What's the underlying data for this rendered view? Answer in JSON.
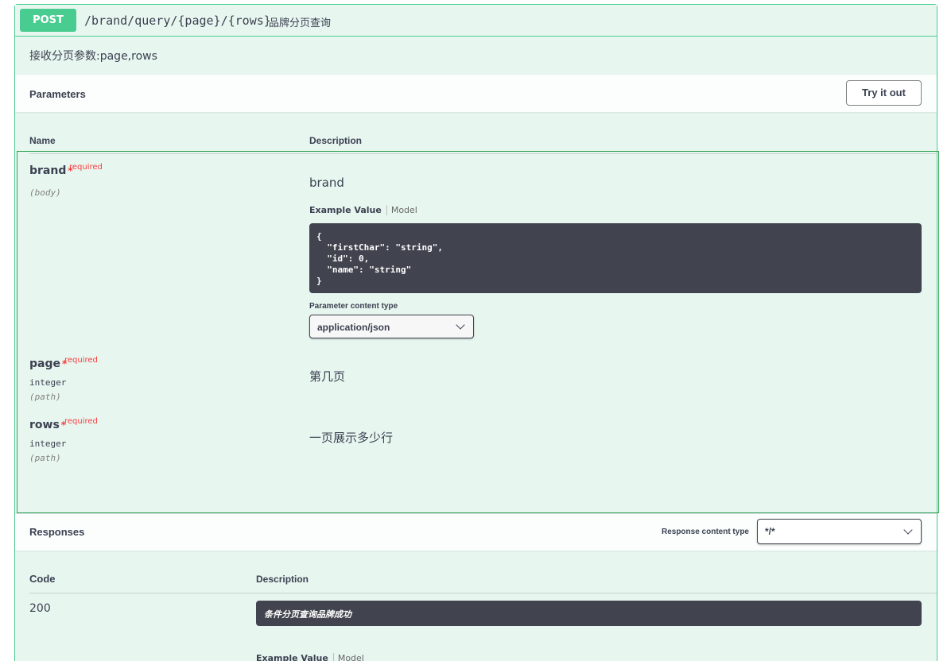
{
  "operation": {
    "method": "POST",
    "path": "/brand/query/{page}/{rows}",
    "summary": "品牌分页查询",
    "description": "接收分页参数:page,rows"
  },
  "parameters": {
    "title": "Parameters",
    "try_it_out": "Try it out",
    "col_name": "Name",
    "col_description": "Description",
    "required_label": "required",
    "required_star": "*",
    "items": [
      {
        "name": "brand",
        "type": "",
        "in": "(body)",
        "description": "brand"
      },
      {
        "name": "page",
        "type": "integer",
        "in": "(path)",
        "description": "第几页"
      },
      {
        "name": "rows",
        "type": "integer",
        "in": "(path)",
        "description": "一页展示多少行"
      }
    ],
    "example_tab": "Example Value",
    "model_tab": "Model",
    "example_code": "{\n  \"firstChar\": \"string\",\n  \"id\": 0,\n  \"name\": \"string\"\n}",
    "content_type_label": "Parameter content type",
    "content_type_value": "application/json"
  },
  "responses": {
    "title": "Responses",
    "content_type_label": "Response content type",
    "content_type_value": "*/*",
    "col_code": "Code",
    "col_description": "Description",
    "rows": [
      {
        "code": "200",
        "description": "条件分页查询品牌成功"
      }
    ],
    "example_tab": "Example Value",
    "model_tab": "Model"
  },
  "colors": {
    "post": "#49cc90",
    "background": "#e8f6f0",
    "required": "#f93e3e",
    "code_bg": "#41444e"
  }
}
